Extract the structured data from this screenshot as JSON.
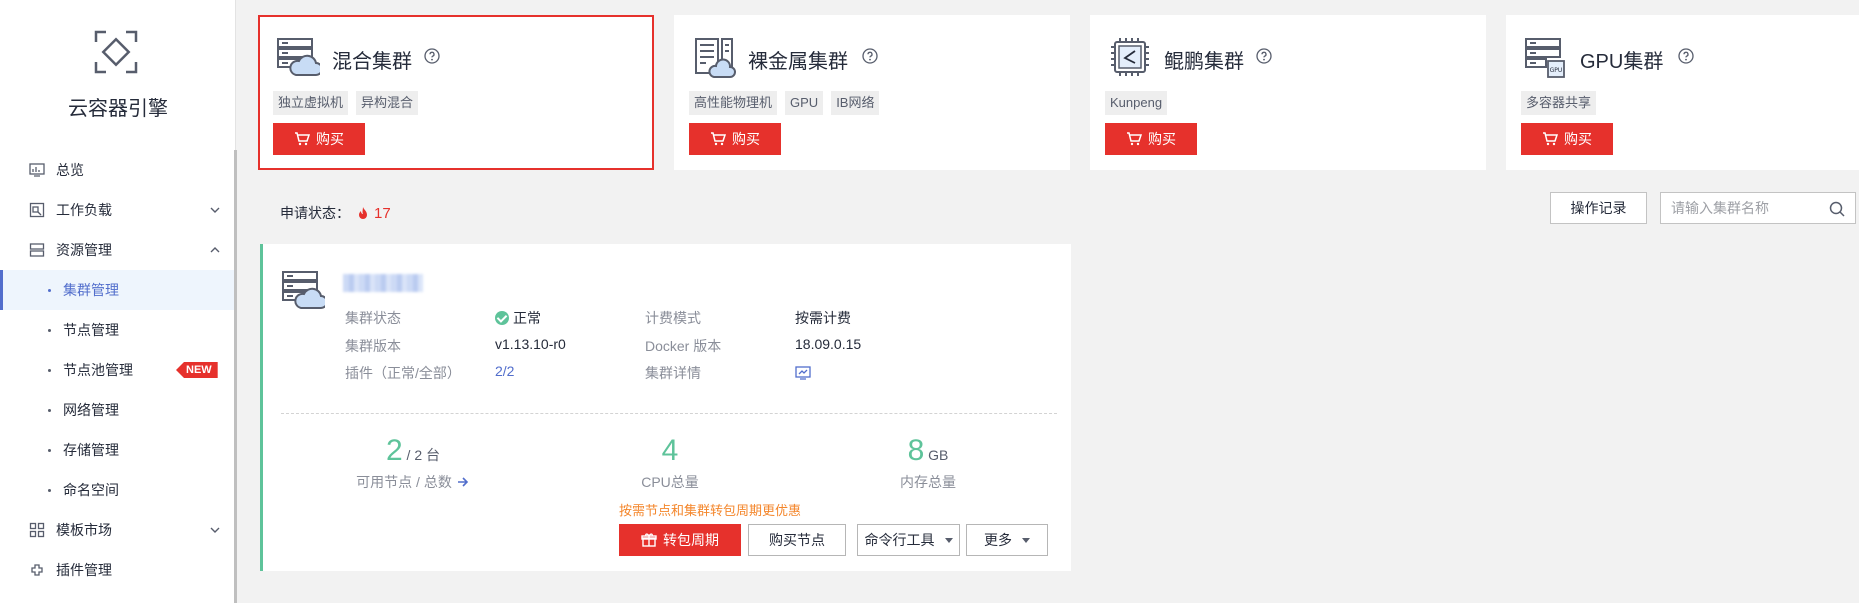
{
  "sidebar": {
    "brand": "云容器引擎",
    "items": [
      {
        "label": "总览",
        "icon": "overview-icon"
      },
      {
        "label": "工作负载",
        "icon": "workload-icon"
      },
      {
        "label": "资源管理",
        "icon": "resource-icon"
      }
    ],
    "sub_items": [
      {
        "label": "集群管理"
      },
      {
        "label": "节点管理"
      },
      {
        "label": "节点池管理",
        "badge": "NEW"
      },
      {
        "label": "网络管理"
      },
      {
        "label": "存储管理"
      },
      {
        "label": "命名空间"
      }
    ],
    "bottom_items": [
      {
        "label": "模板市场",
        "icon": "template-icon"
      },
      {
        "label": "插件管理",
        "icon": "plugin-icon"
      }
    ]
  },
  "cluster_types": [
    {
      "title": "混合集群",
      "tags": [
        "独立虚拟机",
        "异构混合"
      ],
      "buy": "购买"
    },
    {
      "title": "裸金属集群",
      "tags": [
        "高性能物理机",
        "GPU",
        "IB网络"
      ],
      "buy": "购买"
    },
    {
      "title": "鲲鹏集群",
      "tags": [
        "Kunpeng"
      ],
      "buy": "购买"
    },
    {
      "title": "GPU集群",
      "tags": [
        "多容器共享"
      ],
      "buy": "购买"
    }
  ],
  "status": {
    "label": "申请状态：",
    "count": "17"
  },
  "toolbar": {
    "op_log": "操作记录",
    "search_placeholder": "请输入集群名称"
  },
  "cluster": {
    "info": {
      "status_label": "集群状态",
      "status_value": "正常",
      "version_label": "集群版本",
      "version_value": "v1.13.10-r0",
      "addon_label": "插件（正常/全部）",
      "addon_value": "2/2",
      "billing_label": "计费模式",
      "billing_value": "按需计费",
      "docker_label": "Docker 版本",
      "docker_value": "18.09.0.15",
      "detail_label": "集群详情"
    },
    "stats": {
      "nodes_num": "2",
      "nodes_total": "/ 2 台",
      "nodes_caption": "可用节点 / 总数",
      "cpu_num": "4",
      "cpu_caption": "CPU总量",
      "mem_num": "8",
      "mem_unit": "GB",
      "mem_caption": "内存总量"
    },
    "promo": "按需节点和集群转包周期更优惠",
    "actions": {
      "convert": "转包周期",
      "buy_node": "购买节点",
      "cli": "命令行工具",
      "more": "更多"
    }
  },
  "colors": {
    "accent": "#e6312c",
    "success": "#5ec39a",
    "link": "#526ecc"
  }
}
